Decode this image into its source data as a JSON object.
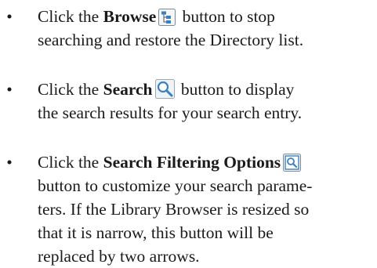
{
  "bullets": [
    {
      "before": "Click the ",
      "bold": "Browse",
      "icon": "browse-tree-icon",
      "line1_after": " button to stop",
      "line2": "searching and restore the Directory list."
    },
    {
      "before": "Click the ",
      "bold": "Search",
      "icon": "magnifier-search-icon",
      "line1_after": " button to display",
      "line2": "the search results for your search entry."
    },
    {
      "before": "Click the ",
      "bold": "Search Filtering Options",
      "icon": "search-filter-options-icon",
      "line2": "button to customize your search parame-",
      "line3": "ters. If the Library Browser is resized so",
      "line4": "that it is narrow, this button will be",
      "line5": "replaced by two arrows."
    }
  ],
  "bullet_glyph": "•",
  "colors": {
    "text": "#1a1a1a",
    "icon_blue": "#3b7fc4",
    "icon_frame": "#7a8a9a"
  }
}
